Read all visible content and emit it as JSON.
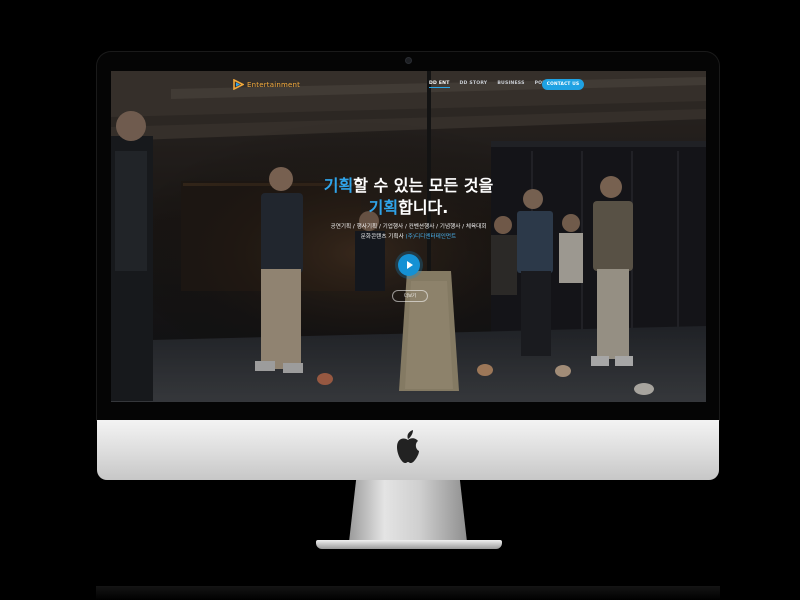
{
  "site": {
    "logo": {
      "text": "Entertainment",
      "icon": "play-triangle-logo-icon"
    },
    "nav": {
      "items": [
        {
          "label": "DD ENT",
          "active": true
        },
        {
          "label": "DD STORY",
          "active": false
        },
        {
          "label": "BUSINESS",
          "active": false
        },
        {
          "label": "PORTFOLIO",
          "active": false
        }
      ],
      "contact_label": "CONTACT US"
    },
    "hero": {
      "title_line1_accent": "기획",
      "title_line1_rest": "할 수 있는 모든 것을",
      "title_line2_accent": "기획",
      "title_line2_rest": "합니다.",
      "subtitle_line1": "공연기획 / 행사기획 / 기업행사 / 컨벤션행사 / 기념행사 / 체육대회",
      "subtitle_line2_prefix": "문화콘텐츠 기획사 ",
      "subtitle_line2_accent": "(주)디디엔터테인먼트",
      "play_icon": "play-icon",
      "more_label": "더보기"
    }
  },
  "device": {
    "logo_icon": "apple-logo-icon",
    "camera_icon": "camera-icon"
  },
  "colors": {
    "accent": "#2fa4ea",
    "logo": "#f2a93b",
    "contact_button": "#1fa2e3",
    "play_button": "#1591d4"
  }
}
